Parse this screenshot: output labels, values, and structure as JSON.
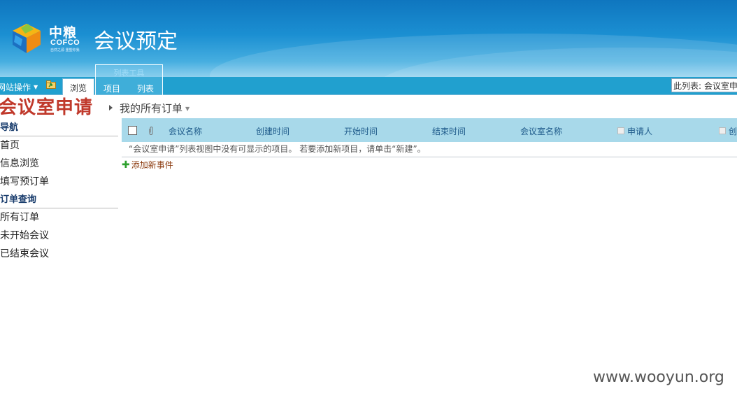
{
  "header": {
    "logo_cn": "中粮",
    "logo_en": "COFCO",
    "logo_sub": "自然之源 重塑你我",
    "site_title": "会议预定"
  },
  "ribbon": {
    "site_actions": "网站操作",
    "tab_browse": "浏览",
    "tools_group": "列表工具",
    "tab_item": "项目",
    "tab_list": "列表",
    "search_scope": "此列表: 会议室申"
  },
  "page": {
    "title": "会议室申请",
    "view_name": "我的所有订单"
  },
  "nav": {
    "sections": [
      {
        "heading": "导航",
        "links": [
          "首页",
          "信息浏览",
          "填写预订单"
        ]
      },
      {
        "heading": "订单查询",
        "links": [
          "所有订单",
          "未开始会议",
          "已结束会议"
        ]
      }
    ]
  },
  "list": {
    "columns": [
      "会议名称",
      "创建时间",
      "开始时间",
      "结束时间",
      "会议室名称",
      "申请人",
      "创"
    ],
    "empty_message": "“会议室申请”列表视图中没有可显示的项目。 若要添加新项目，请单击“新建”。",
    "add_new": "添加新事件"
  },
  "watermark": "www.wooyun.org",
  "colors": {
    "banner": "#1b8fd2",
    "ribbon": "#21a0cf",
    "grid_header": "#a8d9ea",
    "title_red": "#c0392b",
    "add_new": "#8b3a0e"
  }
}
